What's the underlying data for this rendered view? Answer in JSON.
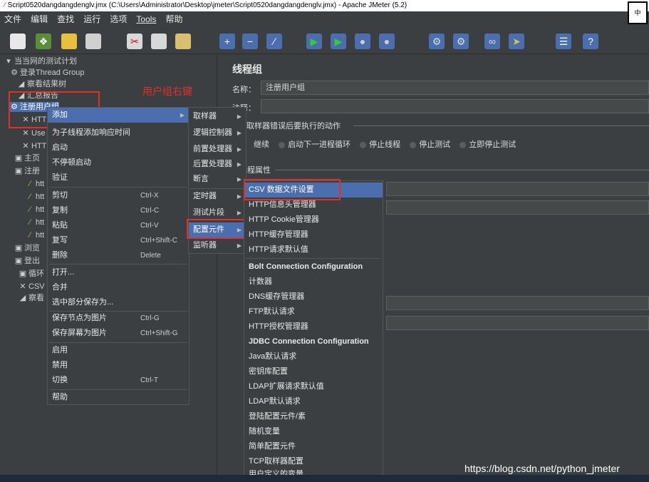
{
  "window": {
    "title": "Script0520dangdangdenglv.jmx (C:\\Users\\Administrator\\Desktop\\jmeter\\Script0520dangdangdenglv.jmx) - Apache JMeter (5.2)",
    "ime_label": "中"
  },
  "menubar": [
    "文件",
    "编辑",
    "查找",
    "运行",
    "选项",
    "Tools",
    "帮助"
  ],
  "tree": {
    "items": [
      {
        "label": "当当网的测试计划",
        "icon": "test-plan-icon"
      },
      {
        "label": "登录Thread Group",
        "icon": "thread-group-icon"
      },
      {
        "label": "察看结果树",
        "icon": "listener-icon"
      },
      {
        "label": "汇总报告",
        "icon": "listener-icon"
      },
      {
        "label": "注册用户组",
        "icon": "thread-group-icon"
      },
      {
        "label": "HTT",
        "icon": "config-icon"
      },
      {
        "label": "Use",
        "icon": "config-icon"
      },
      {
        "label": "HTT",
        "icon": "config-icon"
      },
      {
        "label": "主页",
        "icon": "controller-icon"
      },
      {
        "label": "注册",
        "icon": "controller-icon"
      },
      {
        "label": "htt",
        "icon": "sampler-icon"
      },
      {
        "label": "htt",
        "icon": "sampler-icon"
      },
      {
        "label": "htt",
        "icon": "sampler-icon"
      },
      {
        "label": "htt",
        "icon": "sampler-icon"
      },
      {
        "label": "htt",
        "icon": "sampler-icon"
      },
      {
        "label": "浏览",
        "icon": "controller-icon"
      },
      {
        "label": "登出",
        "icon": "controller-icon"
      },
      {
        "label": "循环",
        "icon": "controller-icon"
      },
      {
        "label": "CSV",
        "icon": "config-icon"
      },
      {
        "label": "察看",
        "icon": "listener-icon"
      }
    ]
  },
  "annotation": "用户组右键",
  "right_panel": {
    "title": "线程组",
    "name_label": "名称：",
    "name_value": "注册用户组",
    "comment_label": "注释：",
    "error_section": "取样器错误后要执行的动作",
    "radio_options": [
      "继续",
      "启动下一进程循环",
      "停止线程",
      "停止测试",
      "立即停止测试"
    ],
    "props_section": "线程属性"
  },
  "context_menu": {
    "items": [
      {
        "label": "添加",
        "shortcut": "",
        "submenu": true
      },
      {
        "label": "为子线程添加响应时间",
        "shortcut": ""
      },
      {
        "label": "启动",
        "shortcut": ""
      },
      {
        "label": "不停顿启动",
        "shortcut": ""
      },
      {
        "label": "验证",
        "shortcut": ""
      },
      {
        "label": "剪切",
        "shortcut": "Ctrl-X"
      },
      {
        "label": "复制",
        "shortcut": "Ctrl-C"
      },
      {
        "label": "粘贴",
        "shortcut": "Ctrl-V"
      },
      {
        "label": "复写",
        "shortcut": "Ctrl+Shift-C"
      },
      {
        "label": "删除",
        "shortcut": "Delete"
      },
      {
        "label": "打开...",
        "shortcut": ""
      },
      {
        "label": "合并",
        "shortcut": ""
      },
      {
        "label": "选中部分保存为...",
        "shortcut": ""
      },
      {
        "label": "保存节点为图片",
        "shortcut": "Ctrl-G"
      },
      {
        "label": "保存屏幕为图片",
        "shortcut": "Ctrl+Shift-G"
      },
      {
        "label": "启用",
        "shortcut": ""
      },
      {
        "label": "禁用",
        "shortcut": ""
      },
      {
        "label": "切换",
        "shortcut": "Ctrl-T"
      },
      {
        "label": "帮助",
        "shortcut": ""
      }
    ]
  },
  "add_submenu": {
    "items": [
      "取样器",
      "逻辑控制器",
      "前置处理器",
      "后置处理器",
      "断言",
      "定时器",
      "测试片段",
      "配置元件",
      "监听器"
    ]
  },
  "config_submenu": {
    "items": [
      "CSV 数据文件设置",
      "HTTP信息头管理器",
      "HTTP Cookie管理器",
      "HTTP缓存管理器",
      "HTTP请求默认值",
      "Bolt Connection Configuration",
      "计数器",
      "DNS缓存管理器",
      "FTP默认请求",
      "HTTP授权管理器",
      "JDBC Connection Configuration",
      "Java默认请求",
      "密钥库配置",
      "LDAP扩展请求默认值",
      "LDAP默认请求",
      "登陆配置元件/素",
      "随机变量",
      "简单配置元件",
      "TCP取样器配置",
      "用户定义的变量"
    ]
  },
  "watermark": "https://blog.csdn.net/python_jmeter",
  "colors": {
    "highlight": "#4b6eaf",
    "annotation_red": "#e0302a",
    "background": "#3c3f41"
  }
}
